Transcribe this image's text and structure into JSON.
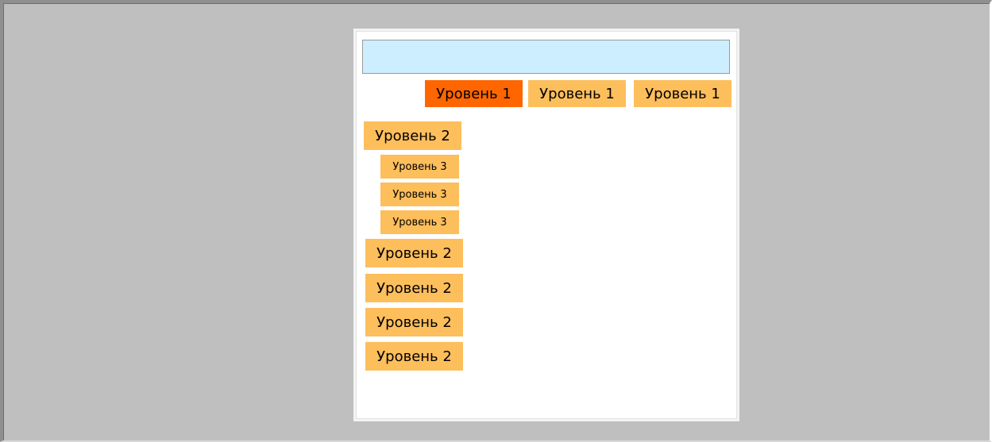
{
  "level1": [
    {
      "label": "Уровень 1",
      "active": true
    },
    {
      "label": "Уровень 1",
      "active": false
    },
    {
      "label": "Уровень 1",
      "active": false
    }
  ],
  "level2_first": {
    "label": "Уровень 2"
  },
  "level3": [
    {
      "label": "Уровень 3"
    },
    {
      "label": "Уровень 3"
    },
    {
      "label": "Уровень 3"
    }
  ],
  "level2_rest": [
    {
      "label": "Уровень 2"
    },
    {
      "label": "Уровень 2"
    },
    {
      "label": "Уровень 2"
    },
    {
      "label": "Уровень 2"
    }
  ],
  "colors": {
    "background": "#bfbfbf",
    "panel": "#ffffff",
    "top_bar": "#cdeefe",
    "menu_item": "#fdbe5c",
    "menu_item_active": "#ff6600"
  }
}
